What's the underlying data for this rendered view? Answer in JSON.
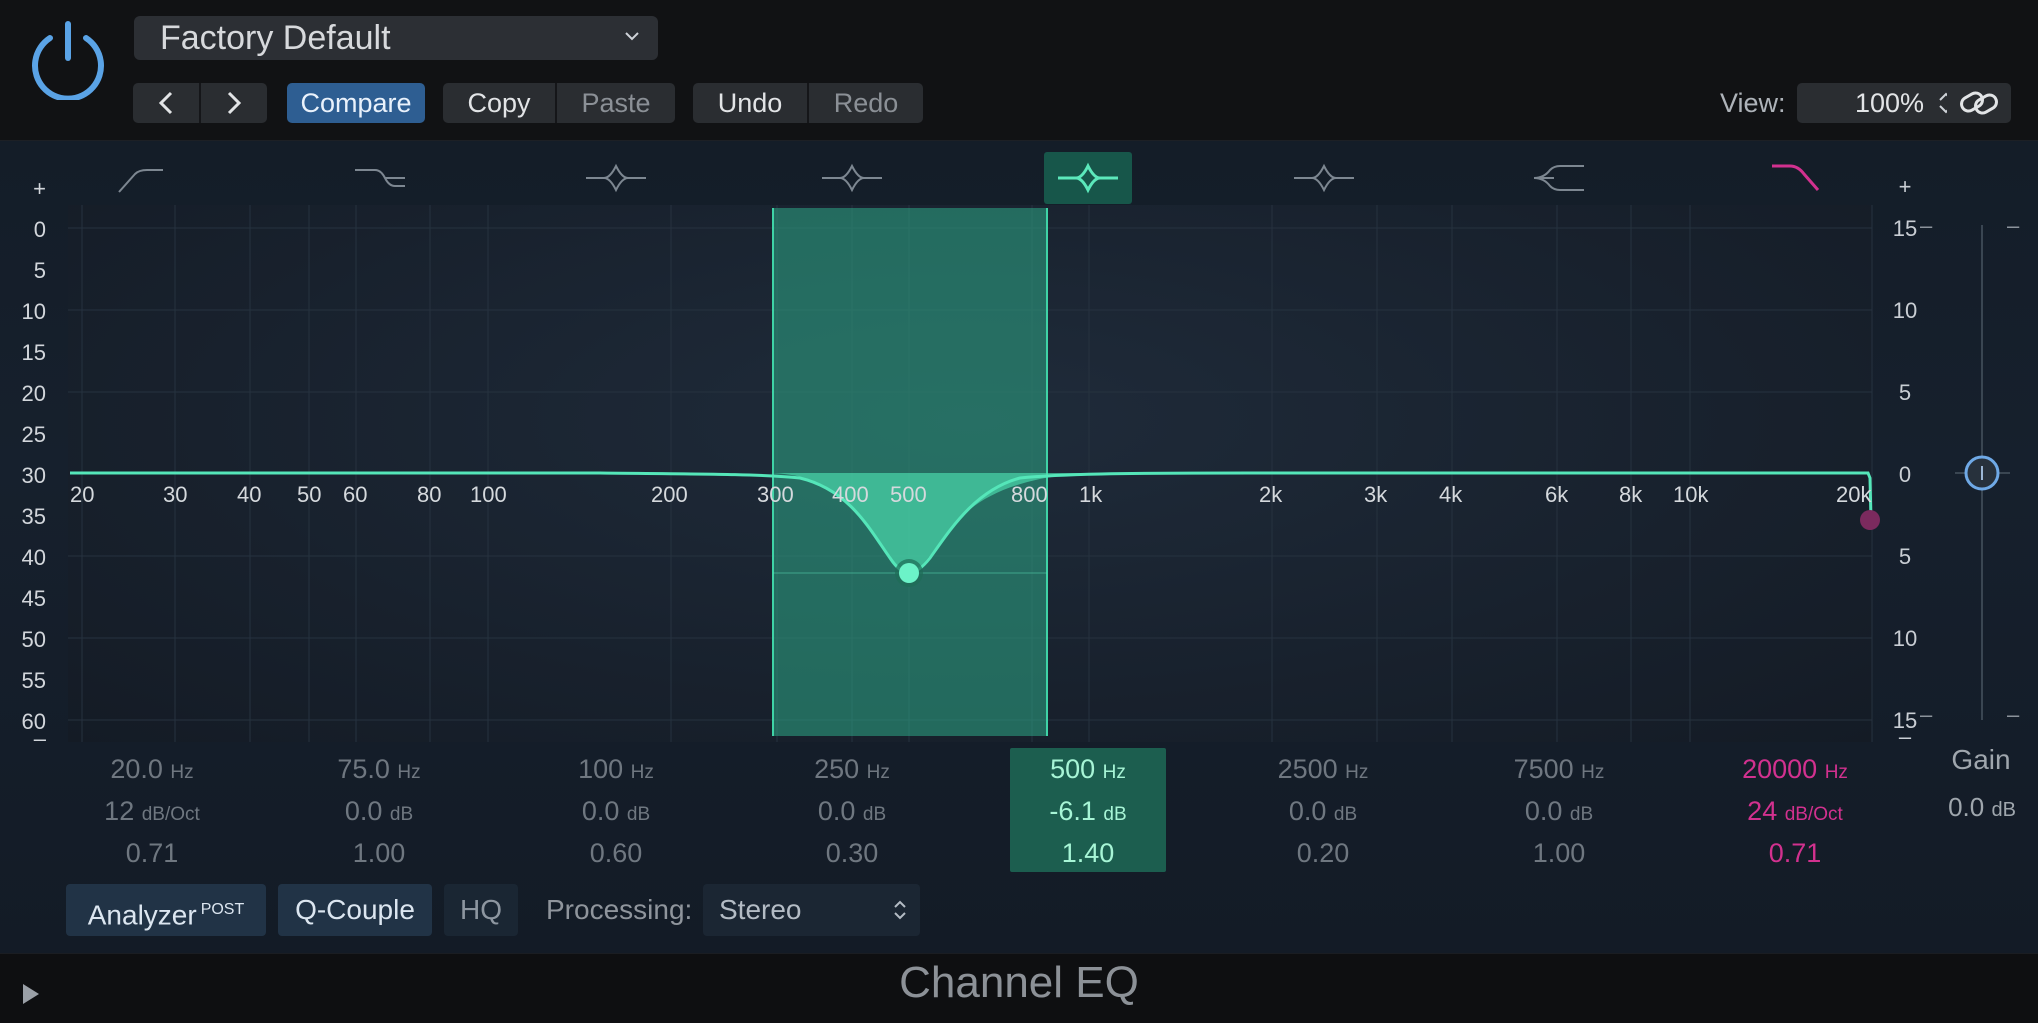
{
  "header": {
    "preset": "Factory Default",
    "compare": "Compare",
    "copy": "Copy",
    "paste": "Paste",
    "undo": "Undo",
    "redo": "Redo",
    "view_label": "View:",
    "zoom": "100%"
  },
  "graph": {
    "left_scale": [
      "+",
      "0",
      "5",
      "10",
      "15",
      "20",
      "25",
      "30",
      "35",
      "40",
      "45",
      "50",
      "55",
      "60",
      "–"
    ],
    "right_scale": [
      "+",
      "15",
      "10",
      "5",
      "0",
      "5",
      "10",
      "15",
      "–"
    ],
    "freq_labels": [
      "20",
      "30",
      "40",
      "50",
      "60",
      "80",
      "100",
      "200",
      "300",
      "400",
      "500",
      "800",
      "1k",
      "2k",
      "3k",
      "4k",
      "6k",
      "8k",
      "10k",
      "20k"
    ]
  },
  "bands": [
    {
      "freq": "20.0",
      "freq_unit": "Hz",
      "gain": "12",
      "gain_unit": "dB/Oct",
      "q": "0.71"
    },
    {
      "freq": "75.0",
      "freq_unit": "Hz",
      "gain": "0.0",
      "gain_unit": "dB",
      "q": "1.00"
    },
    {
      "freq": "100",
      "freq_unit": "Hz",
      "gain": "0.0",
      "gain_unit": "dB",
      "q": "0.60"
    },
    {
      "freq": "250",
      "freq_unit": "Hz",
      "gain": "0.0",
      "gain_unit": "dB",
      "q": "0.30"
    },
    {
      "freq": "500",
      "freq_unit": "Hz",
      "gain": "-6.1",
      "gain_unit": "dB",
      "q": "1.40"
    },
    {
      "freq": "2500",
      "freq_unit": "Hz",
      "gain": "0.0",
      "gain_unit": "dB",
      "q": "0.20"
    },
    {
      "freq": "7500",
      "freq_unit": "Hz",
      "gain": "0.0",
      "gain_unit": "dB",
      "q": "1.00"
    },
    {
      "freq": "20000",
      "freq_unit": "Hz",
      "gain": "24",
      "gain_unit": "dB/Oct",
      "q": "0.71"
    }
  ],
  "gain": {
    "label": "Gain",
    "value": "0.0",
    "unit": "dB"
  },
  "bottom": {
    "analyzer": "Analyzer",
    "analyzer_sup": "POST",
    "qcouple": "Q-Couple",
    "hq": "HQ",
    "processing_label": "Processing:",
    "processing_value": "Stereo"
  },
  "footer": {
    "title": "Channel EQ"
  },
  "colors": {
    "accent": "#4de0b0",
    "pink": "#d2318f",
    "blue": "#2e5e92"
  }
}
